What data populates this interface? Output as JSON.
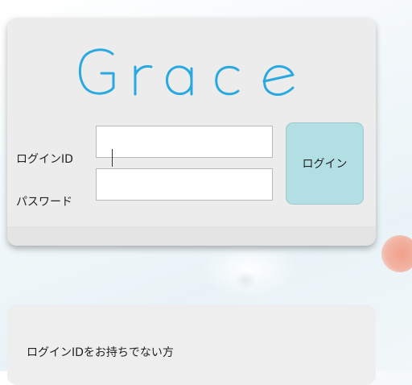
{
  "login": {
    "logo_text": "Grace",
    "id_label": "ログインID",
    "id_value": "",
    "password_label": "パスワード",
    "password_value": "",
    "submit_label": "ログイン"
  },
  "signup": {
    "prompt_text": "ログインIDをお持ちでない方"
  },
  "colors": {
    "logo": "#2aa8e0",
    "login_button": "#b2dfe3",
    "card": "#ececec"
  }
}
